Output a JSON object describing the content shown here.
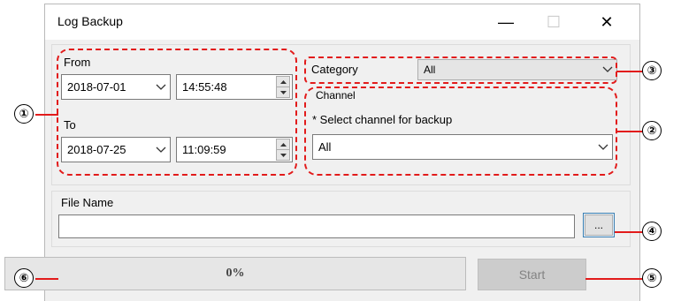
{
  "window": {
    "title": "Log Backup",
    "controls": {
      "minimize": "—",
      "maximize": "☐",
      "close": "✕"
    }
  },
  "from": {
    "label": "From",
    "date": "2018-07-01",
    "time": "14:55:48"
  },
  "to": {
    "label": "To",
    "date": "2018-07-25",
    "time": "11:09:59"
  },
  "category": {
    "label": "Category",
    "value": "All"
  },
  "channel": {
    "group_label": "Channel",
    "hint": "* Select channel for backup",
    "value": "All"
  },
  "file": {
    "label": "File Name",
    "value": "",
    "browse_label": "..."
  },
  "progress": {
    "percent": 0,
    "text": "0%"
  },
  "start_label": "Start",
  "callouts": [
    "①",
    "②",
    "③",
    "④",
    "⑤",
    "⑥"
  ],
  "colors": {
    "annotation": "#e21b1b",
    "window_bg": "#f0f0f0"
  },
  "icons": {
    "dropdown": "chevron-down-icon",
    "spin_up": "triangle-up-icon",
    "spin_down": "triangle-down-icon"
  }
}
